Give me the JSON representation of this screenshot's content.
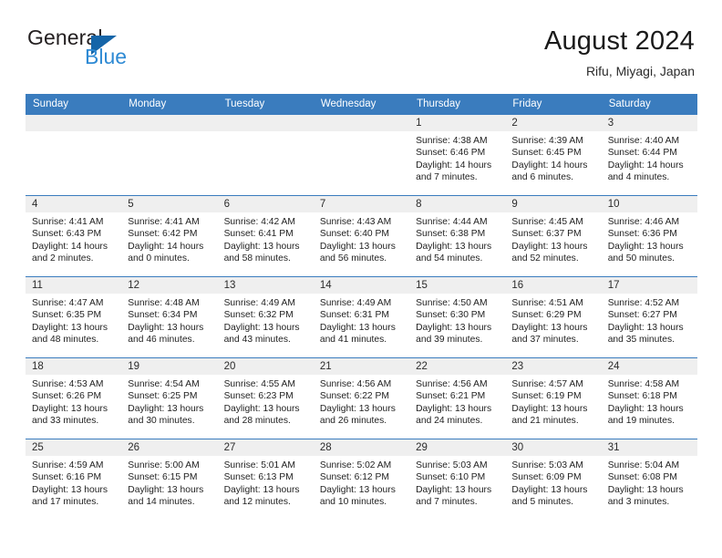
{
  "brand": {
    "name_top": "General",
    "name_bottom": "Blue",
    "triangle_color": "#1565a8",
    "blue_color": "#2e8ad4"
  },
  "header": {
    "title": "August 2024",
    "subtitle": "Rifu, Miyagi, Japan"
  },
  "theme": {
    "header_bar": "#3a7cbe",
    "daynum_band": "#efefef",
    "text": "#1f1f1f"
  },
  "weekdays": [
    "Sunday",
    "Monday",
    "Tuesday",
    "Wednesday",
    "Thursday",
    "Friday",
    "Saturday"
  ],
  "weeks": [
    [
      {
        "day": "",
        "empty": true
      },
      {
        "day": "",
        "empty": true
      },
      {
        "day": "",
        "empty": true
      },
      {
        "day": "",
        "empty": true
      },
      {
        "day": "1",
        "sunrise": "Sunrise: 4:38 AM",
        "sunset": "Sunset: 6:46 PM",
        "daylight_1": "Daylight: 14 hours",
        "daylight_2": "and 7 minutes."
      },
      {
        "day": "2",
        "sunrise": "Sunrise: 4:39 AM",
        "sunset": "Sunset: 6:45 PM",
        "daylight_1": "Daylight: 14 hours",
        "daylight_2": "and 6 minutes."
      },
      {
        "day": "3",
        "sunrise": "Sunrise: 4:40 AM",
        "sunset": "Sunset: 6:44 PM",
        "daylight_1": "Daylight: 14 hours",
        "daylight_2": "and 4 minutes."
      }
    ],
    [
      {
        "day": "4",
        "sunrise": "Sunrise: 4:41 AM",
        "sunset": "Sunset: 6:43 PM",
        "daylight_1": "Daylight: 14 hours",
        "daylight_2": "and 2 minutes."
      },
      {
        "day": "5",
        "sunrise": "Sunrise: 4:41 AM",
        "sunset": "Sunset: 6:42 PM",
        "daylight_1": "Daylight: 14 hours",
        "daylight_2": "and 0 minutes."
      },
      {
        "day": "6",
        "sunrise": "Sunrise: 4:42 AM",
        "sunset": "Sunset: 6:41 PM",
        "daylight_1": "Daylight: 13 hours",
        "daylight_2": "and 58 minutes."
      },
      {
        "day": "7",
        "sunrise": "Sunrise: 4:43 AM",
        "sunset": "Sunset: 6:40 PM",
        "daylight_1": "Daylight: 13 hours",
        "daylight_2": "and 56 minutes."
      },
      {
        "day": "8",
        "sunrise": "Sunrise: 4:44 AM",
        "sunset": "Sunset: 6:38 PM",
        "daylight_1": "Daylight: 13 hours",
        "daylight_2": "and 54 minutes."
      },
      {
        "day": "9",
        "sunrise": "Sunrise: 4:45 AM",
        "sunset": "Sunset: 6:37 PM",
        "daylight_1": "Daylight: 13 hours",
        "daylight_2": "and 52 minutes."
      },
      {
        "day": "10",
        "sunrise": "Sunrise: 4:46 AM",
        "sunset": "Sunset: 6:36 PM",
        "daylight_1": "Daylight: 13 hours",
        "daylight_2": "and 50 minutes."
      }
    ],
    [
      {
        "day": "11",
        "sunrise": "Sunrise: 4:47 AM",
        "sunset": "Sunset: 6:35 PM",
        "daylight_1": "Daylight: 13 hours",
        "daylight_2": "and 48 minutes."
      },
      {
        "day": "12",
        "sunrise": "Sunrise: 4:48 AM",
        "sunset": "Sunset: 6:34 PM",
        "daylight_1": "Daylight: 13 hours",
        "daylight_2": "and 46 minutes."
      },
      {
        "day": "13",
        "sunrise": "Sunrise: 4:49 AM",
        "sunset": "Sunset: 6:32 PM",
        "daylight_1": "Daylight: 13 hours",
        "daylight_2": "and 43 minutes."
      },
      {
        "day": "14",
        "sunrise": "Sunrise: 4:49 AM",
        "sunset": "Sunset: 6:31 PM",
        "daylight_1": "Daylight: 13 hours",
        "daylight_2": "and 41 minutes."
      },
      {
        "day": "15",
        "sunrise": "Sunrise: 4:50 AM",
        "sunset": "Sunset: 6:30 PM",
        "daylight_1": "Daylight: 13 hours",
        "daylight_2": "and 39 minutes."
      },
      {
        "day": "16",
        "sunrise": "Sunrise: 4:51 AM",
        "sunset": "Sunset: 6:29 PM",
        "daylight_1": "Daylight: 13 hours",
        "daylight_2": "and 37 minutes."
      },
      {
        "day": "17",
        "sunrise": "Sunrise: 4:52 AM",
        "sunset": "Sunset: 6:27 PM",
        "daylight_1": "Daylight: 13 hours",
        "daylight_2": "and 35 minutes."
      }
    ],
    [
      {
        "day": "18",
        "sunrise": "Sunrise: 4:53 AM",
        "sunset": "Sunset: 6:26 PM",
        "daylight_1": "Daylight: 13 hours",
        "daylight_2": "and 33 minutes."
      },
      {
        "day": "19",
        "sunrise": "Sunrise: 4:54 AM",
        "sunset": "Sunset: 6:25 PM",
        "daylight_1": "Daylight: 13 hours",
        "daylight_2": "and 30 minutes."
      },
      {
        "day": "20",
        "sunrise": "Sunrise: 4:55 AM",
        "sunset": "Sunset: 6:23 PM",
        "daylight_1": "Daylight: 13 hours",
        "daylight_2": "and 28 minutes."
      },
      {
        "day": "21",
        "sunrise": "Sunrise: 4:56 AM",
        "sunset": "Sunset: 6:22 PM",
        "daylight_1": "Daylight: 13 hours",
        "daylight_2": "and 26 minutes."
      },
      {
        "day": "22",
        "sunrise": "Sunrise: 4:56 AM",
        "sunset": "Sunset: 6:21 PM",
        "daylight_1": "Daylight: 13 hours",
        "daylight_2": "and 24 minutes."
      },
      {
        "day": "23",
        "sunrise": "Sunrise: 4:57 AM",
        "sunset": "Sunset: 6:19 PM",
        "daylight_1": "Daylight: 13 hours",
        "daylight_2": "and 21 minutes."
      },
      {
        "day": "24",
        "sunrise": "Sunrise: 4:58 AM",
        "sunset": "Sunset: 6:18 PM",
        "daylight_1": "Daylight: 13 hours",
        "daylight_2": "and 19 minutes."
      }
    ],
    [
      {
        "day": "25",
        "sunrise": "Sunrise: 4:59 AM",
        "sunset": "Sunset: 6:16 PM",
        "daylight_1": "Daylight: 13 hours",
        "daylight_2": "and 17 minutes."
      },
      {
        "day": "26",
        "sunrise": "Sunrise: 5:00 AM",
        "sunset": "Sunset: 6:15 PM",
        "daylight_1": "Daylight: 13 hours",
        "daylight_2": "and 14 minutes."
      },
      {
        "day": "27",
        "sunrise": "Sunrise: 5:01 AM",
        "sunset": "Sunset: 6:13 PM",
        "daylight_1": "Daylight: 13 hours",
        "daylight_2": "and 12 minutes."
      },
      {
        "day": "28",
        "sunrise": "Sunrise: 5:02 AM",
        "sunset": "Sunset: 6:12 PM",
        "daylight_1": "Daylight: 13 hours",
        "daylight_2": "and 10 minutes."
      },
      {
        "day": "29",
        "sunrise": "Sunrise: 5:03 AM",
        "sunset": "Sunset: 6:10 PM",
        "daylight_1": "Daylight: 13 hours",
        "daylight_2": "and 7 minutes."
      },
      {
        "day": "30",
        "sunrise": "Sunrise: 5:03 AM",
        "sunset": "Sunset: 6:09 PM",
        "daylight_1": "Daylight: 13 hours",
        "daylight_2": "and 5 minutes."
      },
      {
        "day": "31",
        "sunrise": "Sunrise: 5:04 AM",
        "sunset": "Sunset: 6:08 PM",
        "daylight_1": "Daylight: 13 hours",
        "daylight_2": "and 3 minutes."
      }
    ]
  ]
}
